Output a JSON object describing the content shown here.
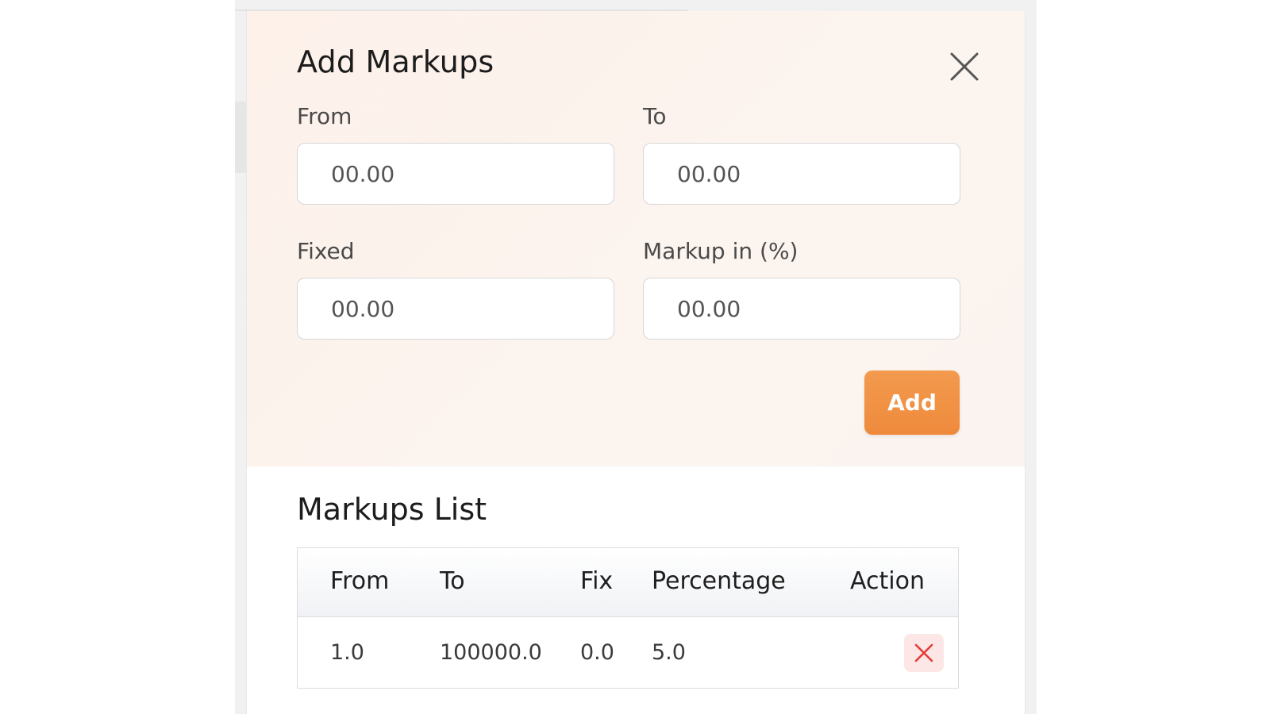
{
  "modal": {
    "title": "Add Markups",
    "close_icon": "close-icon",
    "fields": {
      "from": {
        "label": "From",
        "placeholder": "00.00"
      },
      "to": {
        "label": "To",
        "placeholder": "00.00"
      },
      "fixed": {
        "label": "Fixed",
        "placeholder": "00.00"
      },
      "markup_percent": {
        "label": "Markup in (%)",
        "placeholder": "00.00"
      }
    },
    "add_button": "Add",
    "accent_color": "#f0913f"
  },
  "markups_list": {
    "title": "Markups List",
    "columns": [
      "From",
      "To",
      "Fix",
      "Percentage",
      "Action"
    ],
    "rows": [
      {
        "from": "1.0",
        "to": "100000.0",
        "fix": "0.0",
        "percentage": "5.0",
        "action_icon": "delete-x-icon"
      }
    ],
    "delete_color": "#e53935"
  }
}
